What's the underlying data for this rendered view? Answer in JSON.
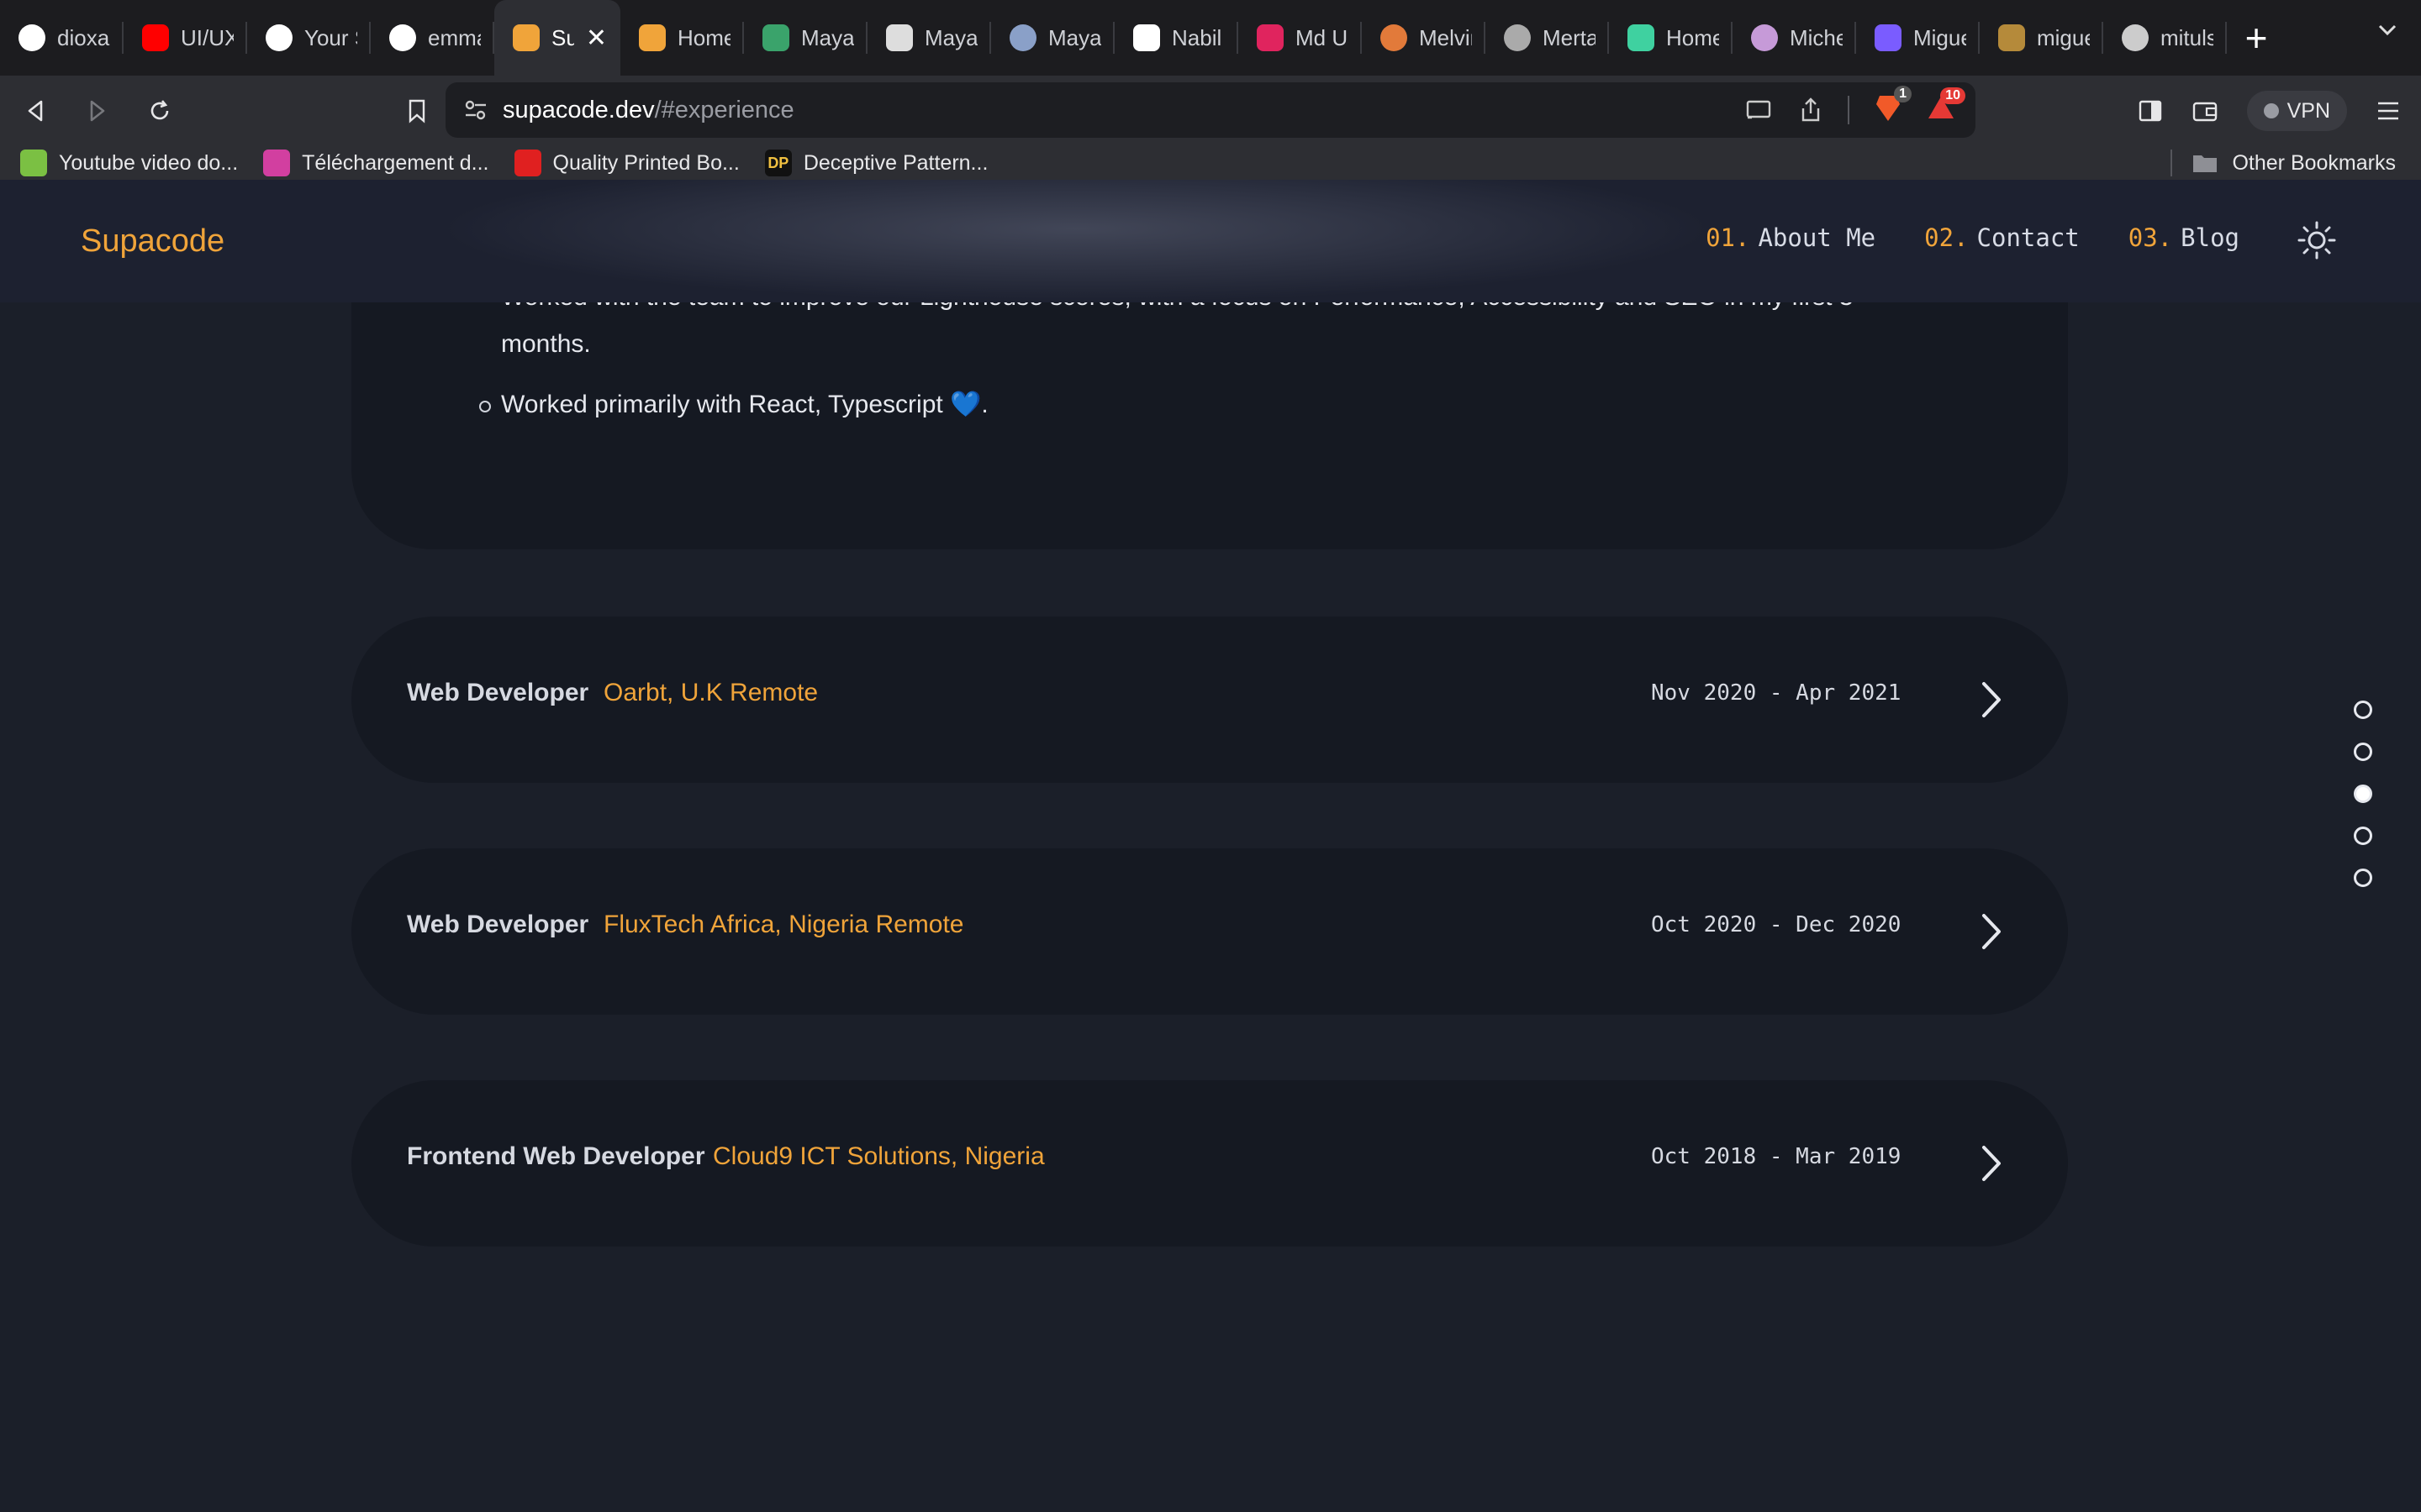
{
  "browser": {
    "tabs": [
      {
        "title": "dioxaz",
        "icon": "google-icon",
        "color": "#ffffff"
      },
      {
        "title": "UI/UX",
        "icon": "youtube-icon",
        "color": "#ff0000"
      },
      {
        "title": "Your S",
        "icon": "github-icon",
        "color": "#ffffff"
      },
      {
        "title": "emmal",
        "icon": "github-icon",
        "color": "#ffffff"
      },
      {
        "title": "Su",
        "icon": "supacode-icon",
        "color": "#f0a43a",
        "active": true
      },
      {
        "title": "Home",
        "icon": "site-icon",
        "color": "#f0a43a"
      },
      {
        "title": "Maya",
        "icon": "site-icon",
        "color": "#3aa36b"
      },
      {
        "title": "Mayan",
        "icon": "site-icon",
        "color": "#dddddd"
      },
      {
        "title": "Mayan",
        "icon": "avatar-icon",
        "color": "#8aa0c8"
      },
      {
        "title": "Nabil",
        "icon": "notion-icon",
        "color": "#ffffff"
      },
      {
        "title": "Md Us",
        "icon": "site-icon",
        "color": "#e0245e"
      },
      {
        "title": "Melvin",
        "icon": "avatar-icon",
        "color": "#e27a3a"
      },
      {
        "title": "Merta",
        "icon": "globe-icon",
        "color": "#aaaaaa"
      },
      {
        "title": "Home",
        "icon": "site-icon",
        "color": "#3fd1a0"
      },
      {
        "title": "Michel",
        "icon": "avatar-icon",
        "color": "#c69ad8"
      },
      {
        "title": "Miguel",
        "icon": "code-icon",
        "color": "#7a5cff"
      },
      {
        "title": "migue",
        "icon": "site-icon",
        "color": "#b58a3a"
      },
      {
        "title": "mituls",
        "icon": "avatar-icon",
        "color": "#cccccc"
      }
    ],
    "url_host": "supacode.dev",
    "url_path": "/#experience",
    "brave_badge": "1",
    "alert_badge": "10",
    "vpn_label": "VPN",
    "bookmarks": [
      {
        "label": "Youtube video do...",
        "color": "#7bc043"
      },
      {
        "label": "Téléchargement d...",
        "color": "#d23fa0"
      },
      {
        "label": "Quality Printed Bo...",
        "color": "#e02020"
      },
      {
        "label": "Deceptive Pattern...",
        "color": "#111111",
        "glyph": "DP"
      }
    ],
    "other_bookmarks": "Other Bookmarks"
  },
  "site": {
    "logo": "Supacode",
    "nav": [
      {
        "num": "01.",
        "label": "About Me"
      },
      {
        "num": "02.",
        "label": "Contact"
      },
      {
        "num": "03.",
        "label": "Blog"
      }
    ],
    "accent_color": "#f0a43a"
  },
  "experience": {
    "expanded_bullets": {
      "partial_line_1": "Worked with the team to improve our Lighthouse scores, with a focus on Performance, Accessibility and SEO in my first 3",
      "partial_line_2": "months.",
      "line_3": "Worked primarily with React, Typescript 💙."
    },
    "jobs": [
      {
        "role": "Web Developer",
        "company": "Oarbt, U.K Remote",
        "dates": "Nov 2020 - Apr 2021"
      },
      {
        "role": "Web Developer",
        "company": "FluxTech Africa, Nigeria Remote",
        "dates": "Oct 2020 - Dec 2020"
      },
      {
        "role": "Frontend Web Developer",
        "company": "Cloud9 ICT Solutions, Nigeria",
        "dates": "Oct 2018 - Mar 2019"
      }
    ]
  },
  "section_dots": {
    "count": 5,
    "active_index": 2
  }
}
